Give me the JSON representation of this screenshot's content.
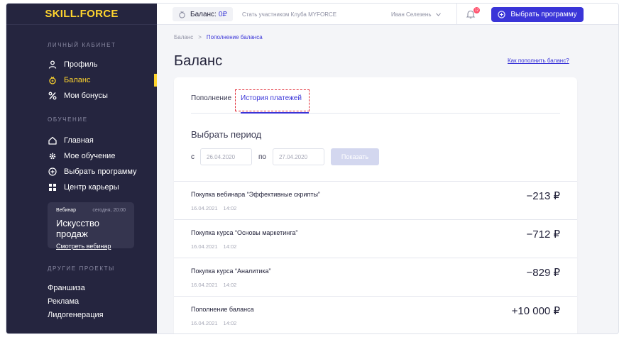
{
  "logo": "SKILL.FORCE",
  "sidebar": {
    "section_account": "ЛИЧНЫЙ КАБИНЕТ",
    "account_items": [
      {
        "label": "Профиль",
        "icon": "user-icon"
      },
      {
        "label": "Баланс",
        "icon": "wallet-icon",
        "active": true
      },
      {
        "label": "Мои бонусы",
        "icon": "percent-icon"
      }
    ],
    "section_learning": "ОБУЧЕНИЕ",
    "learning_items": [
      {
        "label": "Главная",
        "icon": "home-icon"
      },
      {
        "label": "Мое обучение",
        "icon": "gear-icon"
      },
      {
        "label": "Выбрать программу",
        "icon": "plus-circle-icon"
      },
      {
        "label": "Центр карьеры",
        "icon": "grid-icon"
      }
    ],
    "webinar": {
      "tag": "Вебинар",
      "date": "сегодня, 20:00",
      "title": "Искусство продаж",
      "link": "Смотреть вебинар"
    },
    "section_other": "ДРУГИЕ ПРОЕКТЫ",
    "other_links": [
      "Франшиза",
      "Реклама",
      "Лидогенерация"
    ]
  },
  "topbar": {
    "balance_label": "Баланс:",
    "balance_value": "0₽",
    "club_link": "Стать участником Клуба MYFORCE",
    "user_name": "Иван Селезень",
    "notifications_count": "12",
    "cta_label": "Выбрать программу"
  },
  "main": {
    "breadcrumb": [
      "Баланс",
      "Пополнение баланса"
    ],
    "title": "Баланс",
    "how_link": "Как пополнить баланс?",
    "tabs": [
      "Пополнение",
      "История платежей"
    ],
    "period": {
      "title": "Выбрать период",
      "from_label": "с",
      "from_value": "26.04.2020",
      "to_label": "по",
      "to_value": "27.04.2020",
      "show_label": "Показать"
    },
    "transactions": [
      {
        "title": "Покупка вебинара “Эффективные скрипты”",
        "date": "16.04.2021",
        "time": "14:02",
        "amount": "−213 ₽"
      },
      {
        "title": "Покупка курса “Основы маркетинга”",
        "date": "16.04.2021",
        "time": "14:02",
        "amount": "−712 ₽"
      },
      {
        "title": "Покупка курса “Аналитика”",
        "date": "16.04.2021",
        "time": "14:02",
        "amount": "−829 ₽"
      },
      {
        "title": "Пополнение баланса",
        "date": "16.04.2021",
        "time": "14:02",
        "amount": "+10 000 ₽"
      }
    ]
  },
  "colors": {
    "sidebar_bg": "#25253f",
    "accent_yellow": "#ffd52e",
    "primary": "#3a35d8",
    "highlight_red": "#e2303a"
  }
}
